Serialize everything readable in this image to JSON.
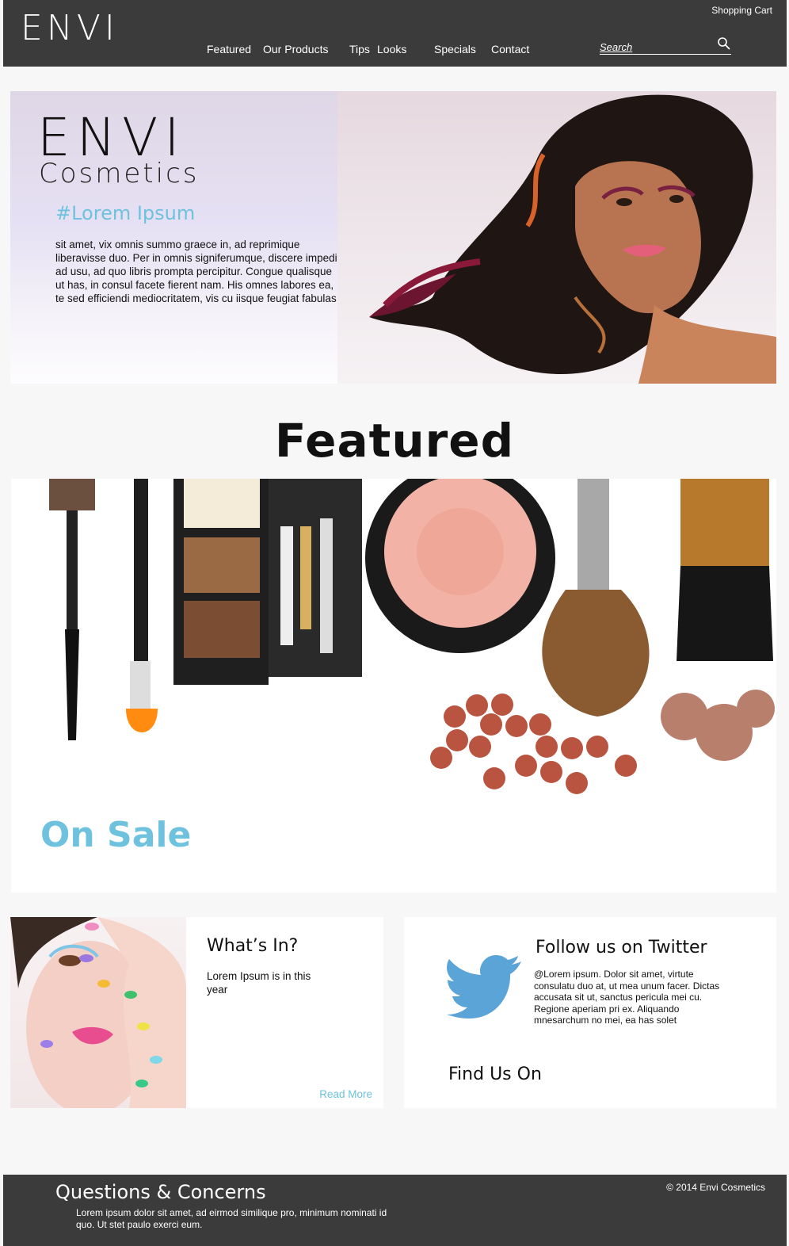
{
  "header": {
    "logo": "ENVI",
    "cart_label": "Shopping Cart",
    "nav": [
      "Featured",
      "Our Products",
      "Tips",
      "Looks",
      "Specials",
      "Contact"
    ],
    "search_placeholder": "Search"
  },
  "hero": {
    "brand": "ENVI",
    "subbrand": "Cosmetics",
    "hashtag": "#Lorem Ipsum",
    "text": "sit amet, vix omnis summo graece in, ad reprimique liberavisse duo. Per in omnis signiferumque, discere impedit ad usu, ad quo libris prompta percipitur. Congue qualisque ut has, in consul facete fierent nam. His omnes labores ea, te sed efficiendi mediocritatem, vis cu iisque feugiat fabulas."
  },
  "featured": {
    "title": "Featured",
    "sale_label": "On Sale"
  },
  "whats_in": {
    "title": "What’s In?",
    "text": "Lorem Ipsum is in this year",
    "link": "Read More"
  },
  "twitter": {
    "title": "Follow us on Twitter",
    "text": "@Lorem ipsum. Dolor sit amet, virtute consulatu duo at, ut mea unum facer. Dictas accusata sit ut, sanctus pericula mei cu. Regione aperiam pri ex. Aliquando mnesarchum no mei, ea has solet",
    "find_us": "Find Us On"
  },
  "footer": {
    "title": "Questions & Concerns",
    "text": "Lorem ipsum dolor sit amet, ad eirmod similique pro, minimum nominati id quo. Ut stet paulo exerci eum.",
    "copyright": "© 2014 Envi Cosmetics"
  },
  "colors": {
    "header_bg": "#3b3b3b",
    "accent": "#6ec2dd",
    "twitter_blue": "#5aa4d8"
  }
}
